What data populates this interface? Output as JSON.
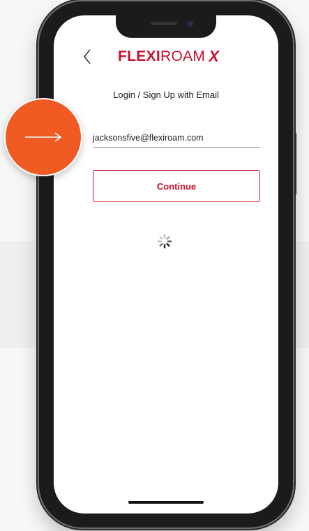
{
  "app": {
    "brand": "FLEXI",
    "brand_light": "ROAM",
    "brand_mark": "X",
    "brand_color": "#c8102e"
  },
  "nav": {
    "back_icon": "chevron-left-icon"
  },
  "screen": {
    "title": "Login / Sign Up with Email",
    "email": {
      "value": "jacksonsfive@flexiroam.com",
      "placeholder": ""
    },
    "continue_label": "Continue",
    "loading_icon": "spinner-icon"
  },
  "overlay": {
    "tap_indicator_icon": "arrow-right-icon",
    "tap_indicator_color": "#f05a23"
  }
}
